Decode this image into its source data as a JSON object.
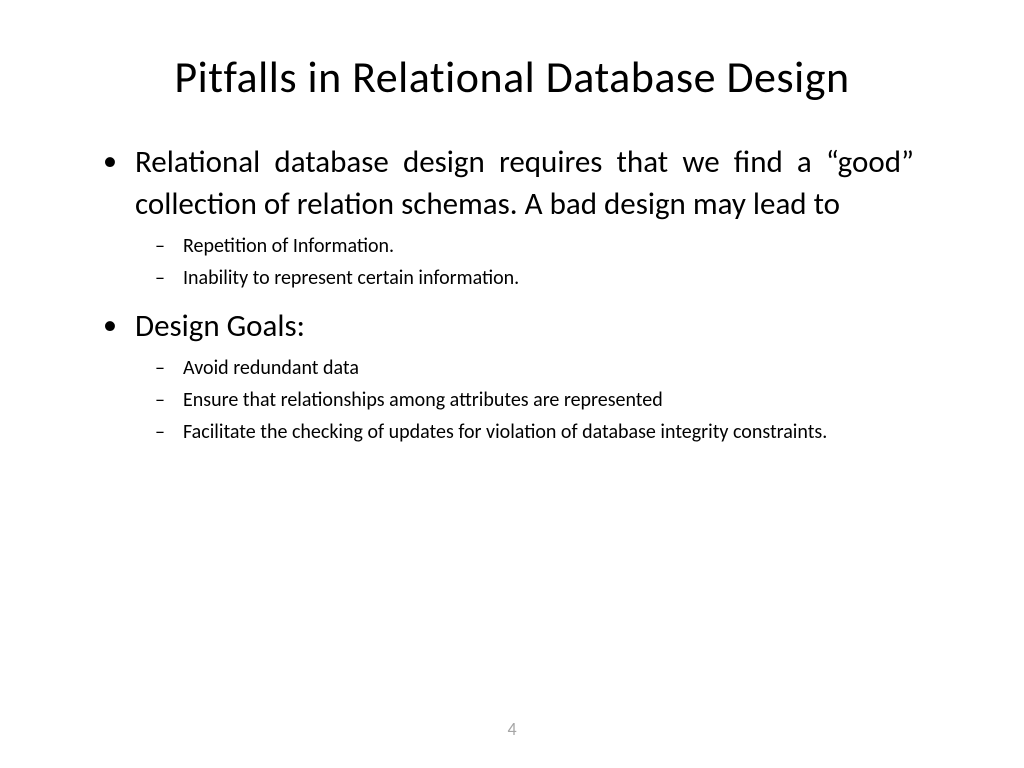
{
  "title": "Pitfalls in Relational Database Design",
  "bullets": [
    {
      "text": "Relational database design requires that we find a “good” collection of relation schemas.  A bad design may lead to",
      "sub": [
        "Repetition of Information.",
        "Inability to represent certain information."
      ]
    },
    {
      "text": "Design Goals:",
      "sub": [
        "Avoid redundant data",
        "Ensure that relationships among attributes are represented",
        "Facilitate the checking of updates for violation of database integrity constraints."
      ]
    }
  ],
  "page_number": "4"
}
